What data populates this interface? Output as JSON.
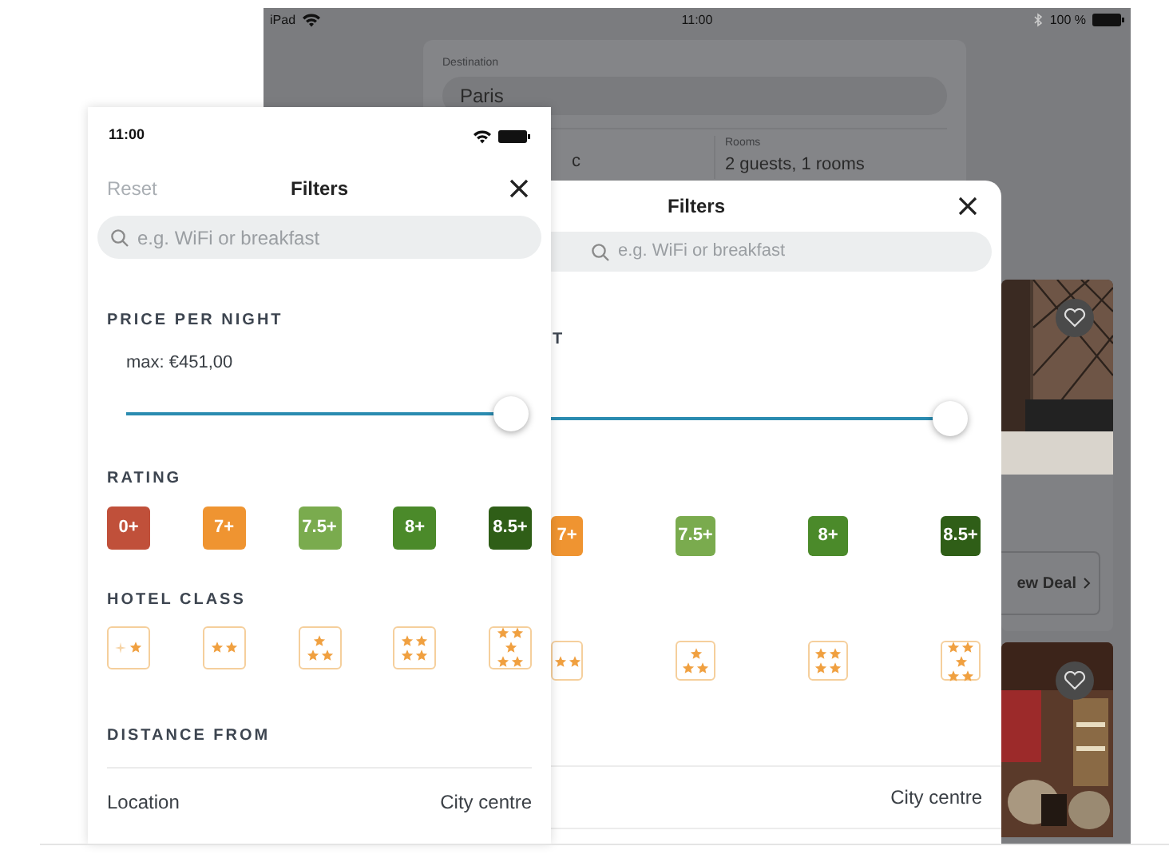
{
  "ipad": {
    "status_bar": {
      "device": "iPad",
      "time": "11:00",
      "battery": "100 %"
    },
    "search_card": {
      "destination_label": "Destination",
      "destination": "Paris",
      "dates_visible": "c",
      "rooms_label": "Rooms",
      "rooms": "2 guests, 1 rooms"
    },
    "hotel_cards": [
      {
        "kind": "full",
        "deal_button": "ew Deal"
      },
      {
        "kind": "photo_only"
      }
    ],
    "filters_sheet": {
      "title": "Filters",
      "search_placeholder": "e.g. WiFi or breakfast",
      "price_heading": "T",
      "price_slider": {
        "level": 1
      },
      "ratings": [
        {
          "label": "7+",
          "color": "#ef9431"
        },
        {
          "label": "7.5+",
          "color": "#7aab4e"
        },
        {
          "label": "8+",
          "color": "#4b8a2a"
        },
        {
          "label": "8.5+",
          "color": "#2f5e17"
        }
      ],
      "hotel_class": [
        {
          "kind": "two_star"
        },
        {
          "kind": "three_star"
        },
        {
          "kind": "four_star"
        },
        {
          "kind": "five_star"
        }
      ],
      "distance_value": "City centre"
    }
  },
  "phone": {
    "time": "11:00",
    "reset": "Reset",
    "reset_disabled": true,
    "title": "Filters",
    "search_placeholder": "e.g. WiFi or breakfast",
    "price_heading": "PRICE PER NIGHT",
    "price_max": "max: €451,00",
    "price_slider": {
      "level": 1
    },
    "rating_heading": "RATING",
    "ratings": [
      {
        "label": "0+",
        "color": "#c0503a"
      },
      {
        "label": "7+",
        "color": "#ef9431"
      },
      {
        "label": "7.5+",
        "color": "#7aab4e"
      },
      {
        "label": "8+",
        "color": "#4b8a2a"
      },
      {
        "label": "8.5+",
        "color": "#2f5e17"
      }
    ],
    "hotel_class_heading": "HOTEL CLASS",
    "hotel_class": [
      {
        "kind": "one_star"
      },
      {
        "kind": "two_star"
      },
      {
        "kind": "three_star"
      },
      {
        "kind": "four_star"
      },
      {
        "kind": "five_star"
      }
    ],
    "distance_heading": "DISTANCE FROM",
    "distance_label": "Location",
    "distance_value": "City centre"
  }
}
